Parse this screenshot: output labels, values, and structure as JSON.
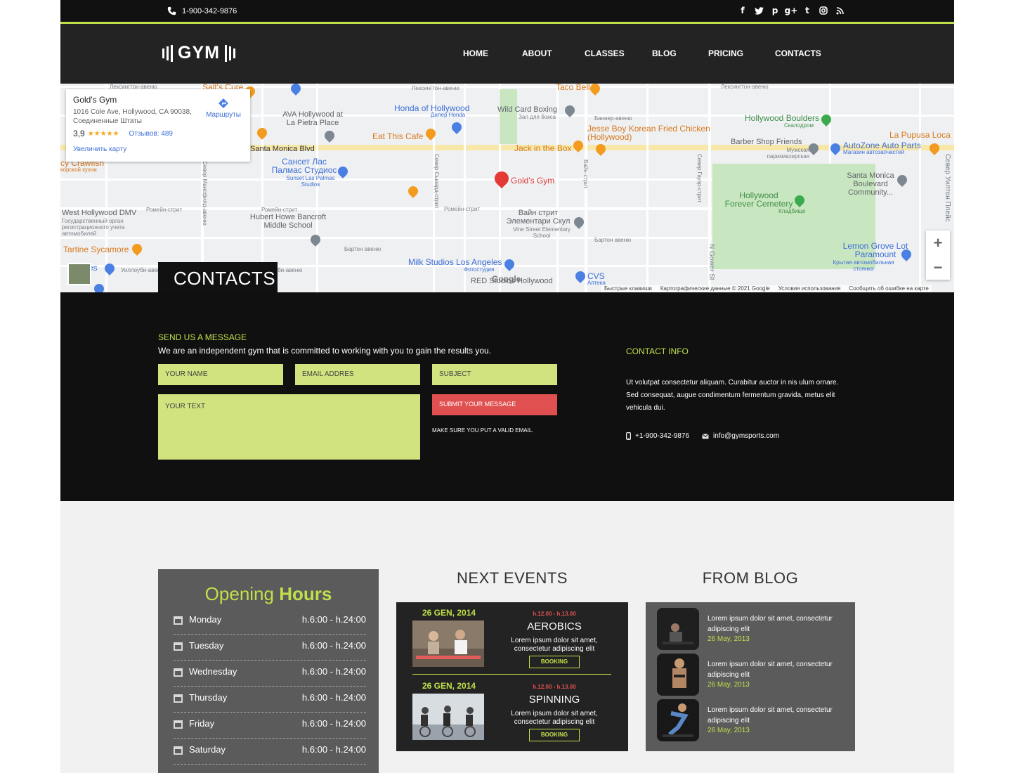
{
  "topbar": {
    "phone": "1-900-342-9876",
    "social": [
      "facebook-icon",
      "twitter-icon",
      "pinterest-icon",
      "google-plus-icon",
      "tumblr-icon",
      "instagram-icon",
      "rss-icon"
    ],
    "social_glyphs": [
      "f",
      "t",
      "p",
      "g+",
      "t",
      "◎",
      "≋"
    ]
  },
  "logo": {
    "text": "GYM"
  },
  "nav": [
    "HOME",
    "ABOUT",
    "CLASSES",
    "BLOG",
    "PRICING",
    "CONTACTS"
  ],
  "map": {
    "info_card": {
      "title": "Gold's Gym",
      "address": "1016 Cole Ave, Hollywood, CA 90038, Соединенные Штаты",
      "rating": "3,9",
      "stars": "★★★★★",
      "reviews": "Отзывов: 489",
      "enlarge": "Увеличить карту",
      "routes": "Маршруты"
    },
    "labels": {
      "golds_gym": "Gold's Gym",
      "santa_monica_blvd": "Santa Monica Blvd",
      "honda": "Honda of Hollywood",
      "honda_sub": "Дилер Honda",
      "ava": "AVA Hollywood at La Pietra Place",
      "eat_this": "Eat This Cafe",
      "wild_card": "Wild Card Boxing",
      "wild_card_sub": "Зал для бокса",
      "jesse": "Jesse Boy Korean Fried Chicken (Hollywood)",
      "jack": "Jack in the Box",
      "taco": "Taco Bell",
      "salts": "Salt's Cure",
      "hollywood_boulders": "Hollywood Boulders",
      "boulders_sub": "Скалодром",
      "barber": "Barber Shop Friends",
      "barber_sub": "Мужская парикмахерская",
      "autozone": "AutoZone Auto Parts",
      "autozone_sub": "Магазин автозапчастей",
      "pupusa": "La Pupusa Loca",
      "santa_monica_bc": "Santa Monica Boulevard Community...",
      "sunset_las": "Сансет Лас Палмас Студиос",
      "sunset_sub": "Sunset Las Palmas Studios",
      "west_dmv": "West Hollywood DMV",
      "dmv_sub": "Государственный орган регистрационного учета автомобилей",
      "hubert": "Hubert Howe Bancroft Middle School",
      "vine_school": "Вайн стрит Элементари Скул",
      "vine_sub": "Vine Street Elementary School",
      "forever": "Hollywood Forever Cemetery",
      "forever_sub": "Кладбище",
      "lemon": "Lemon Grove Lot Paramount",
      "lemon_sub": "Крытая автомобильная стоянка",
      "tartine": "Tartine Sycamore",
      "milk": "Milk Studios Los Angeles",
      "milk_sub": "Фотостудия",
      "cvs": "CVS",
      "cvs_sub": "Аптека",
      "red_studios": "RED Studios Hollywood",
      "crawfish": "cy Crawfish",
      "crawfish_sub": "корской кухни",
      "romaine1": "Ромейн-стрит",
      "romaine2": "Ромейн-стрит",
      "barton": "Бартон авеню",
      "barton2": "Бартон авеню",
      "lexington1": "Лексингтон-авеню",
      "lexington2": "Лексингтон-авеню",
      "lexington3": "Лексингтон-авеню",
      "banner": "Баннер-авеню",
      "willoughby": "Уиллоуби-авеню",
      "seward": "Север Сьюард-стрит",
      "vine": "Вайн-стрит",
      "gower": "Север Гауэр-стрит",
      "n_gower": "N Gower St",
      "wilton": "Север Уилтон Плейс",
      "mansfield": "Север Мансфилд-авеню",
      "rres": "res"
    },
    "google": "Google",
    "footer": [
      "Быстрые клавиши",
      "Картографические данные © 2021 Google",
      "Условия использования",
      "Сообщить об ошибке на карте"
    ],
    "zoom_in": "+",
    "zoom_out": "−"
  },
  "contacts_tab": "CONTACTS",
  "contact": {
    "send_title": "SEND US A MESSAGE",
    "send_sub": "We are an independent gym that is committed to working with you to gain the results you.",
    "name_placeholder": "YOUR NAME",
    "email_placeholder": "EMAIL ADDRES",
    "subject_placeholder": "SUBJECT",
    "text_placeholder": "YOUR TEXT",
    "submit": "SUBMIT YOUR MESSAGE",
    "valid_note": "MAKE SURE YOU PUT A VALID EMAIL.",
    "info_title": "CONTACT INFO",
    "info_text": "Ut volutpat consectetur aliquam. Curabitur auctor in nis ulum ornare. Sed consequat, augue condimentum fermentum gravida, metus elit vehicula dui.",
    "phone": "+1-900-342-9876",
    "email": "info@gymsports.com"
  },
  "hours": {
    "title_a": "Opening ",
    "title_b": "Hours",
    "rows": [
      {
        "day": "Monday",
        "time": "h.6:00 - h.24:00"
      },
      {
        "day": "Tuesday",
        "time": "h.6:00 - h.24:00"
      },
      {
        "day": "Wednesday",
        "time": "h.6:00 - h.24:00"
      },
      {
        "day": "Thursday",
        "time": "h.6:00 - h.24:00"
      },
      {
        "day": "Friday",
        "time": "h.6:00 - h.24:00"
      },
      {
        "day": "Saturday",
        "time": "h.6:00 - h.24:00"
      }
    ]
  },
  "events": {
    "title": "NEXT EVENTS",
    "items": [
      {
        "date": "26 GEN, 2014",
        "time": "h.12.00 - h.13.00",
        "name": "AEROBICS",
        "desc": "Lorem ipsum dolor sit amet, consectetur adipiscing elit",
        "button": "BOOKING"
      },
      {
        "date": "26 GEN, 2014",
        "time": "h.12.00 - h.13.00",
        "name": "SPINNING",
        "desc": "Lorem ipsum dolor sit amet, consectetur adipiscing elit",
        "button": "BOOKING"
      }
    ]
  },
  "blog": {
    "title": "FROM BLOG",
    "items": [
      {
        "text": "Lorem ipsum dolor sit amet, consectetur adipiscing elit",
        "date": "26 May, 2013"
      },
      {
        "text": "Lorem ipsum dolor sit amet, consectetur adipiscing elit",
        "date": "26 May, 2013"
      },
      {
        "text": "Lorem ipsum dolor sit amet, consectetur adipiscing elit",
        "date": "26 May, 2013"
      }
    ]
  },
  "colors": {
    "accent": "#bfe04a",
    "field": "#d1e37e",
    "submit": "#e05050",
    "dark": "#101010",
    "nav": "#232323"
  }
}
